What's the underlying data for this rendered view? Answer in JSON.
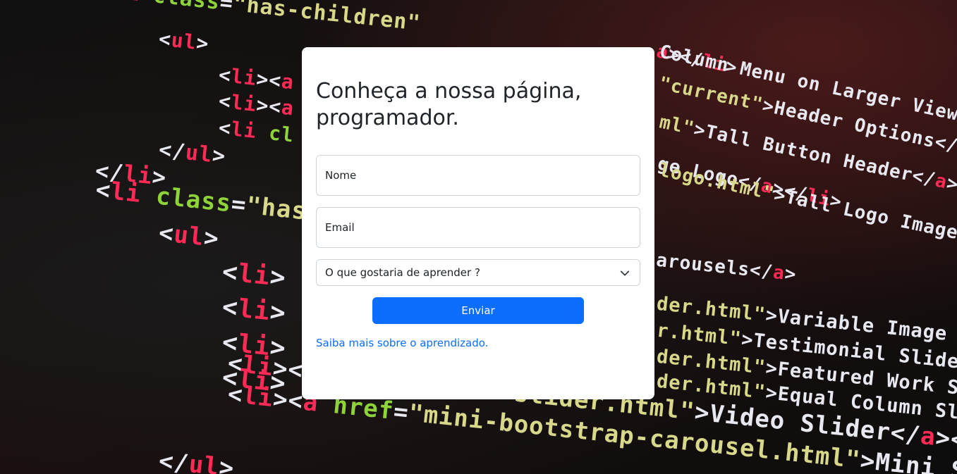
{
  "form": {
    "title": "Conheça a nossa página, programador.",
    "name_placeholder": "Nome",
    "email_placeholder": "Email",
    "select_value": "O que gostaria de aprender ?",
    "submit_label": "Enviar",
    "learn_more_link": "Saiba mais sobre o aprendizado."
  },
  "colors": {
    "primary": "#0d6efd",
    "card_bg": "#ffffff",
    "text": "#212529",
    "border": "#ced4da"
  },
  "background": {
    "description_icon": "code-editor-background"
  }
}
